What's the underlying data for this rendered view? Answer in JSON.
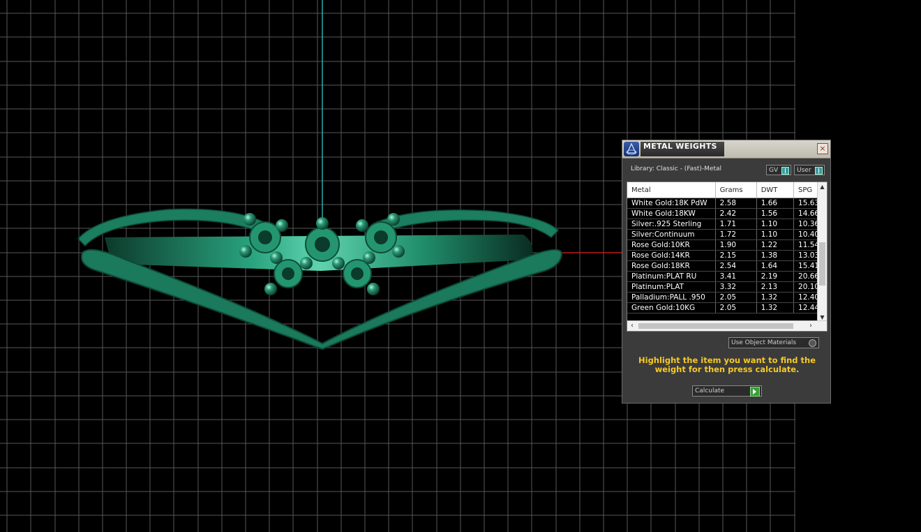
{
  "panel": {
    "title": "METAL WEIGHTS",
    "close_label": "×",
    "library_label": "Library: Classic - (Fast)-Metal",
    "toggle_gv": "GV",
    "toggle_user": "User",
    "columns": [
      "Metal",
      "Grams",
      "DWT",
      "SPG"
    ],
    "rows": [
      [
        "White Gold:18K PdW",
        "2.58",
        "1.66",
        "15.63"
      ],
      [
        "White Gold:18KW",
        "2.42",
        "1.56",
        "14.66"
      ],
      [
        "Silver:.925 Sterling",
        "1.71",
        "1.10",
        "10.36"
      ],
      [
        "Silver:Continuum",
        "1.72",
        "1.10",
        "10.40"
      ],
      [
        "Rose Gold:10KR",
        "1.90",
        "1.22",
        "11.54"
      ],
      [
        "Rose Gold:14KR",
        "2.15",
        "1.38",
        "13.03"
      ],
      [
        "Rose Gold:18KR",
        "2.54",
        "1.64",
        "15.41"
      ],
      [
        "Platinum:PLAT RU",
        "3.41",
        "2.19",
        "20.66"
      ],
      [
        "Platinum:PLAT",
        "3.32",
        "2.13",
        "20.10"
      ],
      [
        "Palladium:PALL .950",
        "2.05",
        "1.32",
        "12.40"
      ],
      [
        "Green Gold:10KG",
        "2.05",
        "1.32",
        "12.44"
      ]
    ],
    "use_object_materials": "Use Object Materials",
    "instruction": "Highlight the item you want to find the weight for then press calculate.",
    "calculate_label": "Calculate",
    "colors": {
      "instruction": "#f6c928",
      "ring": "#1e8a67",
      "grid": "#5a5a5a"
    }
  },
  "viewport": {
    "icon": "ring-model-3d"
  }
}
